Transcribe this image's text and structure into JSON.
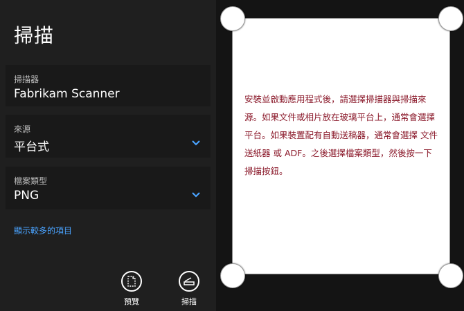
{
  "app": {
    "title": "掃描"
  },
  "fields": {
    "scanner": {
      "label": "掃描器",
      "value": "Fabrikam Scanner"
    },
    "source": {
      "label": "來源",
      "value": "平台式"
    },
    "file_type": {
      "label": "檔案類型",
      "value": "PNG"
    }
  },
  "more_link": "顯示較多的項目",
  "appbar": {
    "preview_label": "預覽",
    "scan_label": "掃描"
  },
  "preview": {
    "instructions": "安裝並啟動應用程式後，請選擇掃描器與掃描來源。如果文件或相片放在玻璃平台上，通常會選擇 平台。如果裝置配有自動送稿器，通常會選擇 文件送紙器 或 ADF。之後選擇檔案類型，然後按一下掃描按鈕。"
  },
  "colors": {
    "accent": "#4aa3ff",
    "instruction_text": "#8b1a2b",
    "background": "#1f1f1f"
  },
  "icons": [
    "chevron-down-icon",
    "preview-icon",
    "scan-icon"
  ]
}
